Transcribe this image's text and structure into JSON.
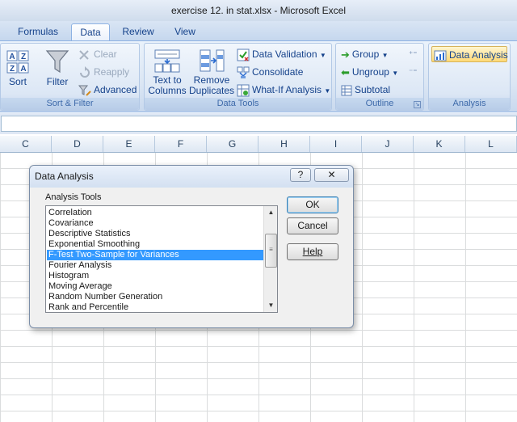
{
  "window": {
    "title": "exercise 12. in stat.xlsx - Microsoft Excel"
  },
  "tabs": [
    {
      "label": "Formulas",
      "active": false
    },
    {
      "label": "Data",
      "active": true
    },
    {
      "label": "Review",
      "active": false
    },
    {
      "label": "View",
      "active": false
    }
  ],
  "ribbon": {
    "sort_filter": {
      "label": "Sort & Filter",
      "sort": "Sort",
      "filter": "Filter",
      "clear": "Clear",
      "reapply": "Reapply",
      "advanced": "Advanced"
    },
    "data_tools": {
      "label": "Data Tools",
      "text_to_columns_line1": "Text to",
      "text_to_columns_line2": "Columns",
      "remove_duplicates_line1": "Remove",
      "remove_duplicates_line2": "Duplicates",
      "data_validation": "Data Validation",
      "consolidate": "Consolidate",
      "what_if": "What-If Analysis"
    },
    "outline": {
      "label": "Outline",
      "group": "Group",
      "ungroup": "Ungroup",
      "subtotal": "Subtotal"
    },
    "analysis": {
      "label": "Analysis",
      "data_analysis": "Data Analysis"
    }
  },
  "columns": [
    "C",
    "D",
    "E",
    "F",
    "G",
    "H",
    "I",
    "J",
    "K",
    "L"
  ],
  "dialog": {
    "title": "Data Analysis",
    "help_icon": "?",
    "close_icon": "✕",
    "list_label": "Analysis Tools",
    "tools": [
      "Correlation",
      "Covariance",
      "Descriptive Statistics",
      "Exponential Smoothing",
      "F-Test Two-Sample for Variances",
      "Fourier Analysis",
      "Histogram",
      "Moving Average",
      "Random Number Generation",
      "Rank and Percentile"
    ],
    "selected_tool": "F-Test Two-Sample for Variances",
    "buttons": {
      "ok": "OK",
      "cancel": "Cancel",
      "help": "Help"
    }
  },
  "colors": {
    "accent": "#15428b",
    "selection": "#3399ff",
    "ribbon": "#dbe6f4"
  }
}
